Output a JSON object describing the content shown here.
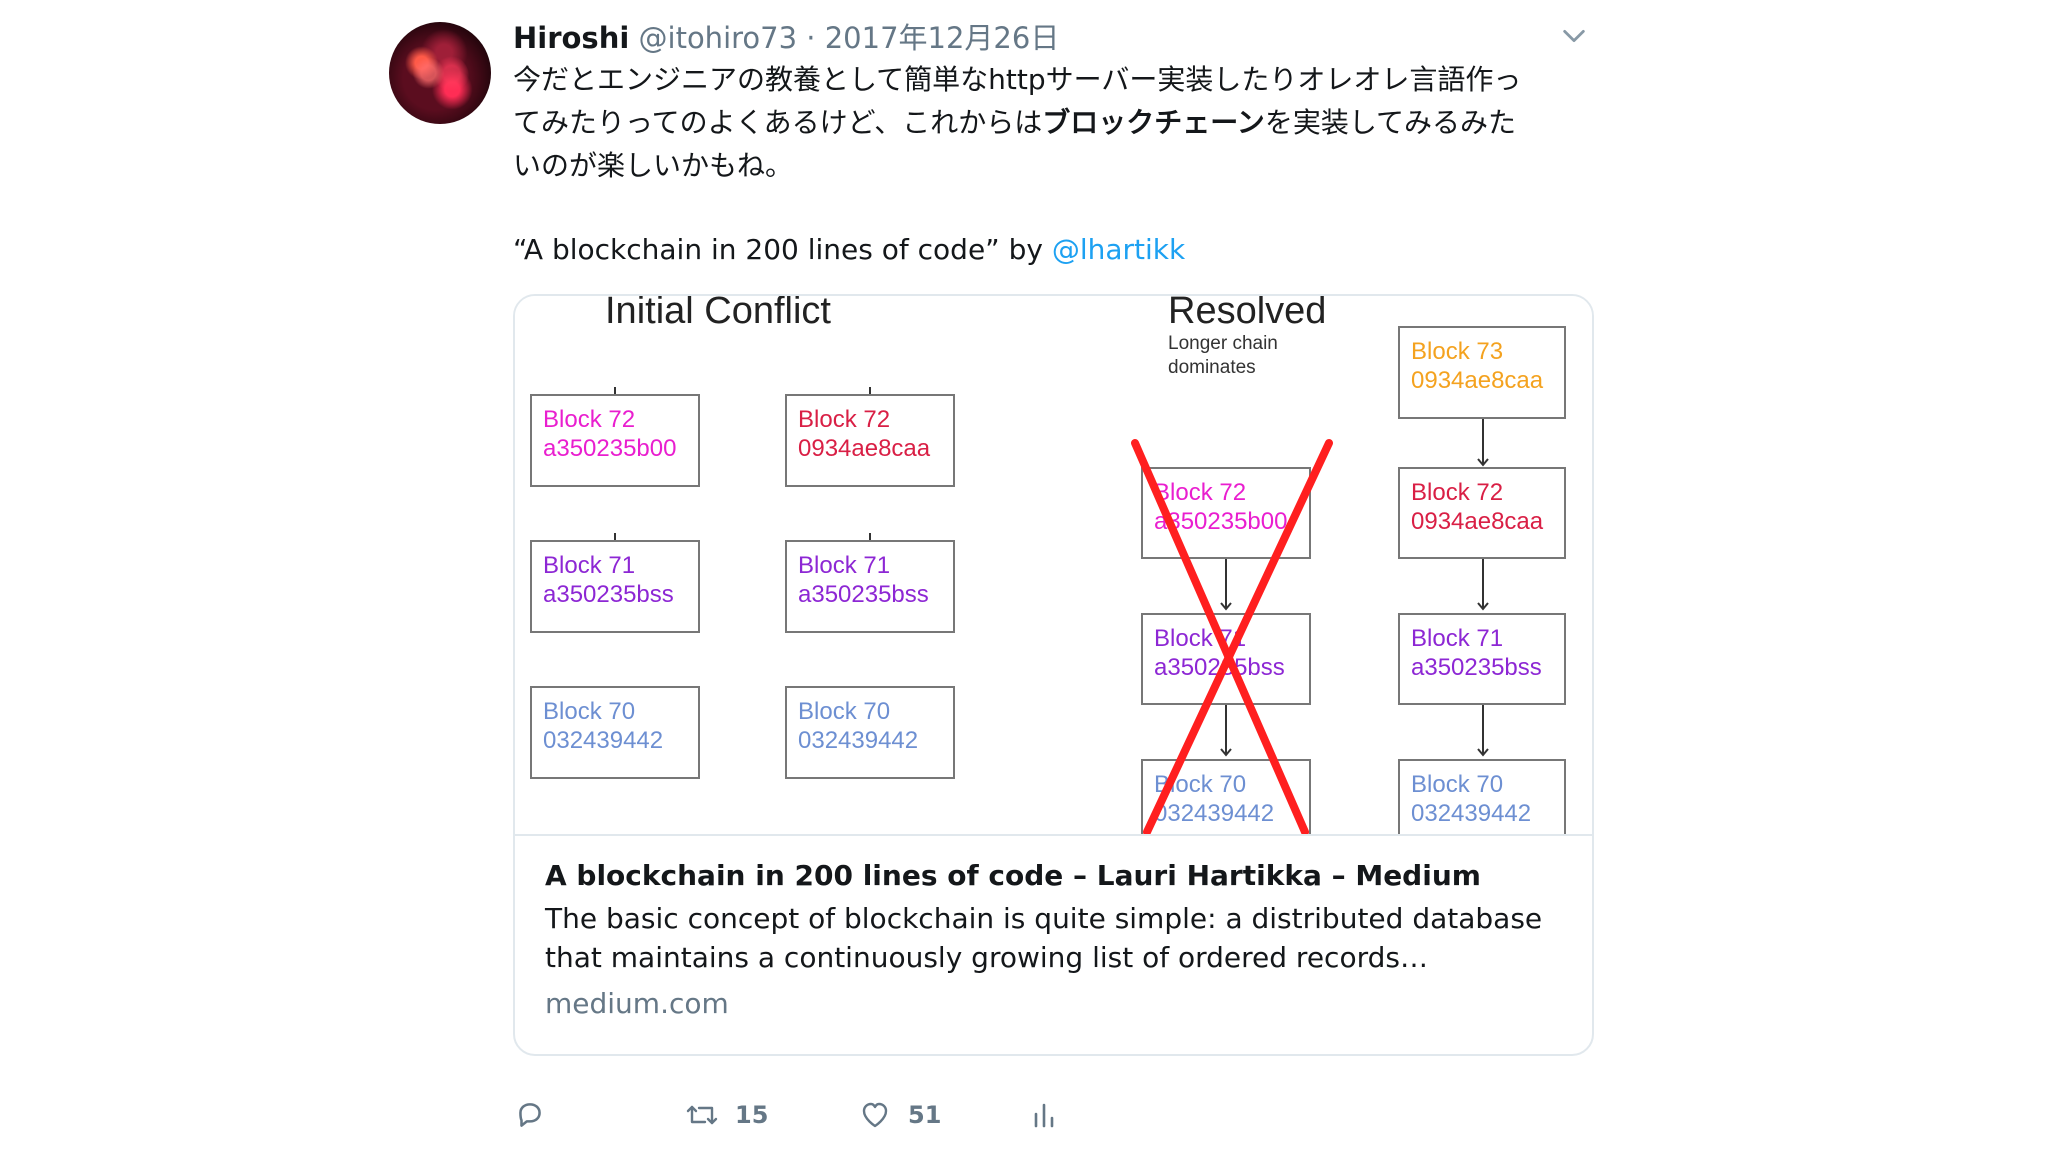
{
  "tweet": {
    "author": {
      "display_name": "Hiroshi",
      "handle": "@itohiro73"
    },
    "separator": "·",
    "date": "2017年12月26日",
    "text_lines": [
      {
        "parts": [
          "今だとエンジニアの教養として簡単なhttpサーバー実装したりオレオレ言語作っ"
        ]
      },
      {
        "parts": [
          "てみたりってのよくあるけど、これからは",
          "ブロックチェーン",
          "を実装してみるみた"
        ]
      },
      {
        "parts": [
          "いのが楽しいかもね。"
        ]
      }
    ],
    "quote_prefix": "“A blockchain in 200 lines of code” by ",
    "mention": "@lhartikk"
  },
  "card": {
    "image": {
      "initial_heading": "Initial Conflict",
      "resolved_heading": "Resolved",
      "resolved_note_line1": "Longer chain",
      "resolved_note_line2": "dominates",
      "chains": {
        "initial_left": [
          {
            "name": "Block 72",
            "hash": "a350235b00",
            "color": "#e91ecf"
          },
          {
            "name": "Block 71",
            "hash": "a350235bss",
            "color": "#8d27d4"
          },
          {
            "name": "Block 70",
            "hash": "032439442",
            "color": "#6d8fd2"
          }
        ],
        "initial_right": [
          {
            "name": "Block 72",
            "hash": "0934ae8caa",
            "color": "#d91f45"
          },
          {
            "name": "Block 71",
            "hash": "a350235bss",
            "color": "#8d27d4"
          },
          {
            "name": "Block 70",
            "hash": "032439442",
            "color": "#6d8fd2"
          }
        ],
        "resolved_discarded": [
          {
            "name": "Block 72",
            "hash": "a350235b00",
            "color": "#e91ecf"
          },
          {
            "name": "Block 71",
            "hash": "a350235bss",
            "color": "#8d27d4"
          },
          {
            "name": "Block 70",
            "hash": "032439442",
            "color": "#6d8fd2"
          }
        ],
        "resolved_winning": [
          {
            "name": "Block 73",
            "hash": "0934ae8caa",
            "color": "#f4a21f"
          },
          {
            "name": "Block 72",
            "hash": "0934ae8caa",
            "color": "#d91f45"
          },
          {
            "name": "Block 71",
            "hash": "a350235bss",
            "color": "#8d27d4"
          },
          {
            "name": "Block 70",
            "hash": "032439442",
            "color": "#6d8fd2"
          }
        ]
      }
    },
    "title": "A blockchain in 200 lines of code – Lauri Hartikka – Medium",
    "description": "The basic concept of blockchain is quite simple: a distributed database that maintains a continuously growing list of ordered records…",
    "domain": "medium.com"
  },
  "actions": {
    "retweet_count": "15",
    "like_count": "51"
  },
  "colors": {
    "link": "#1da1f2",
    "meta": "#657786",
    "text": "#14171a",
    "border": "#e1e8ed",
    "strike": "#ff1f1f"
  }
}
